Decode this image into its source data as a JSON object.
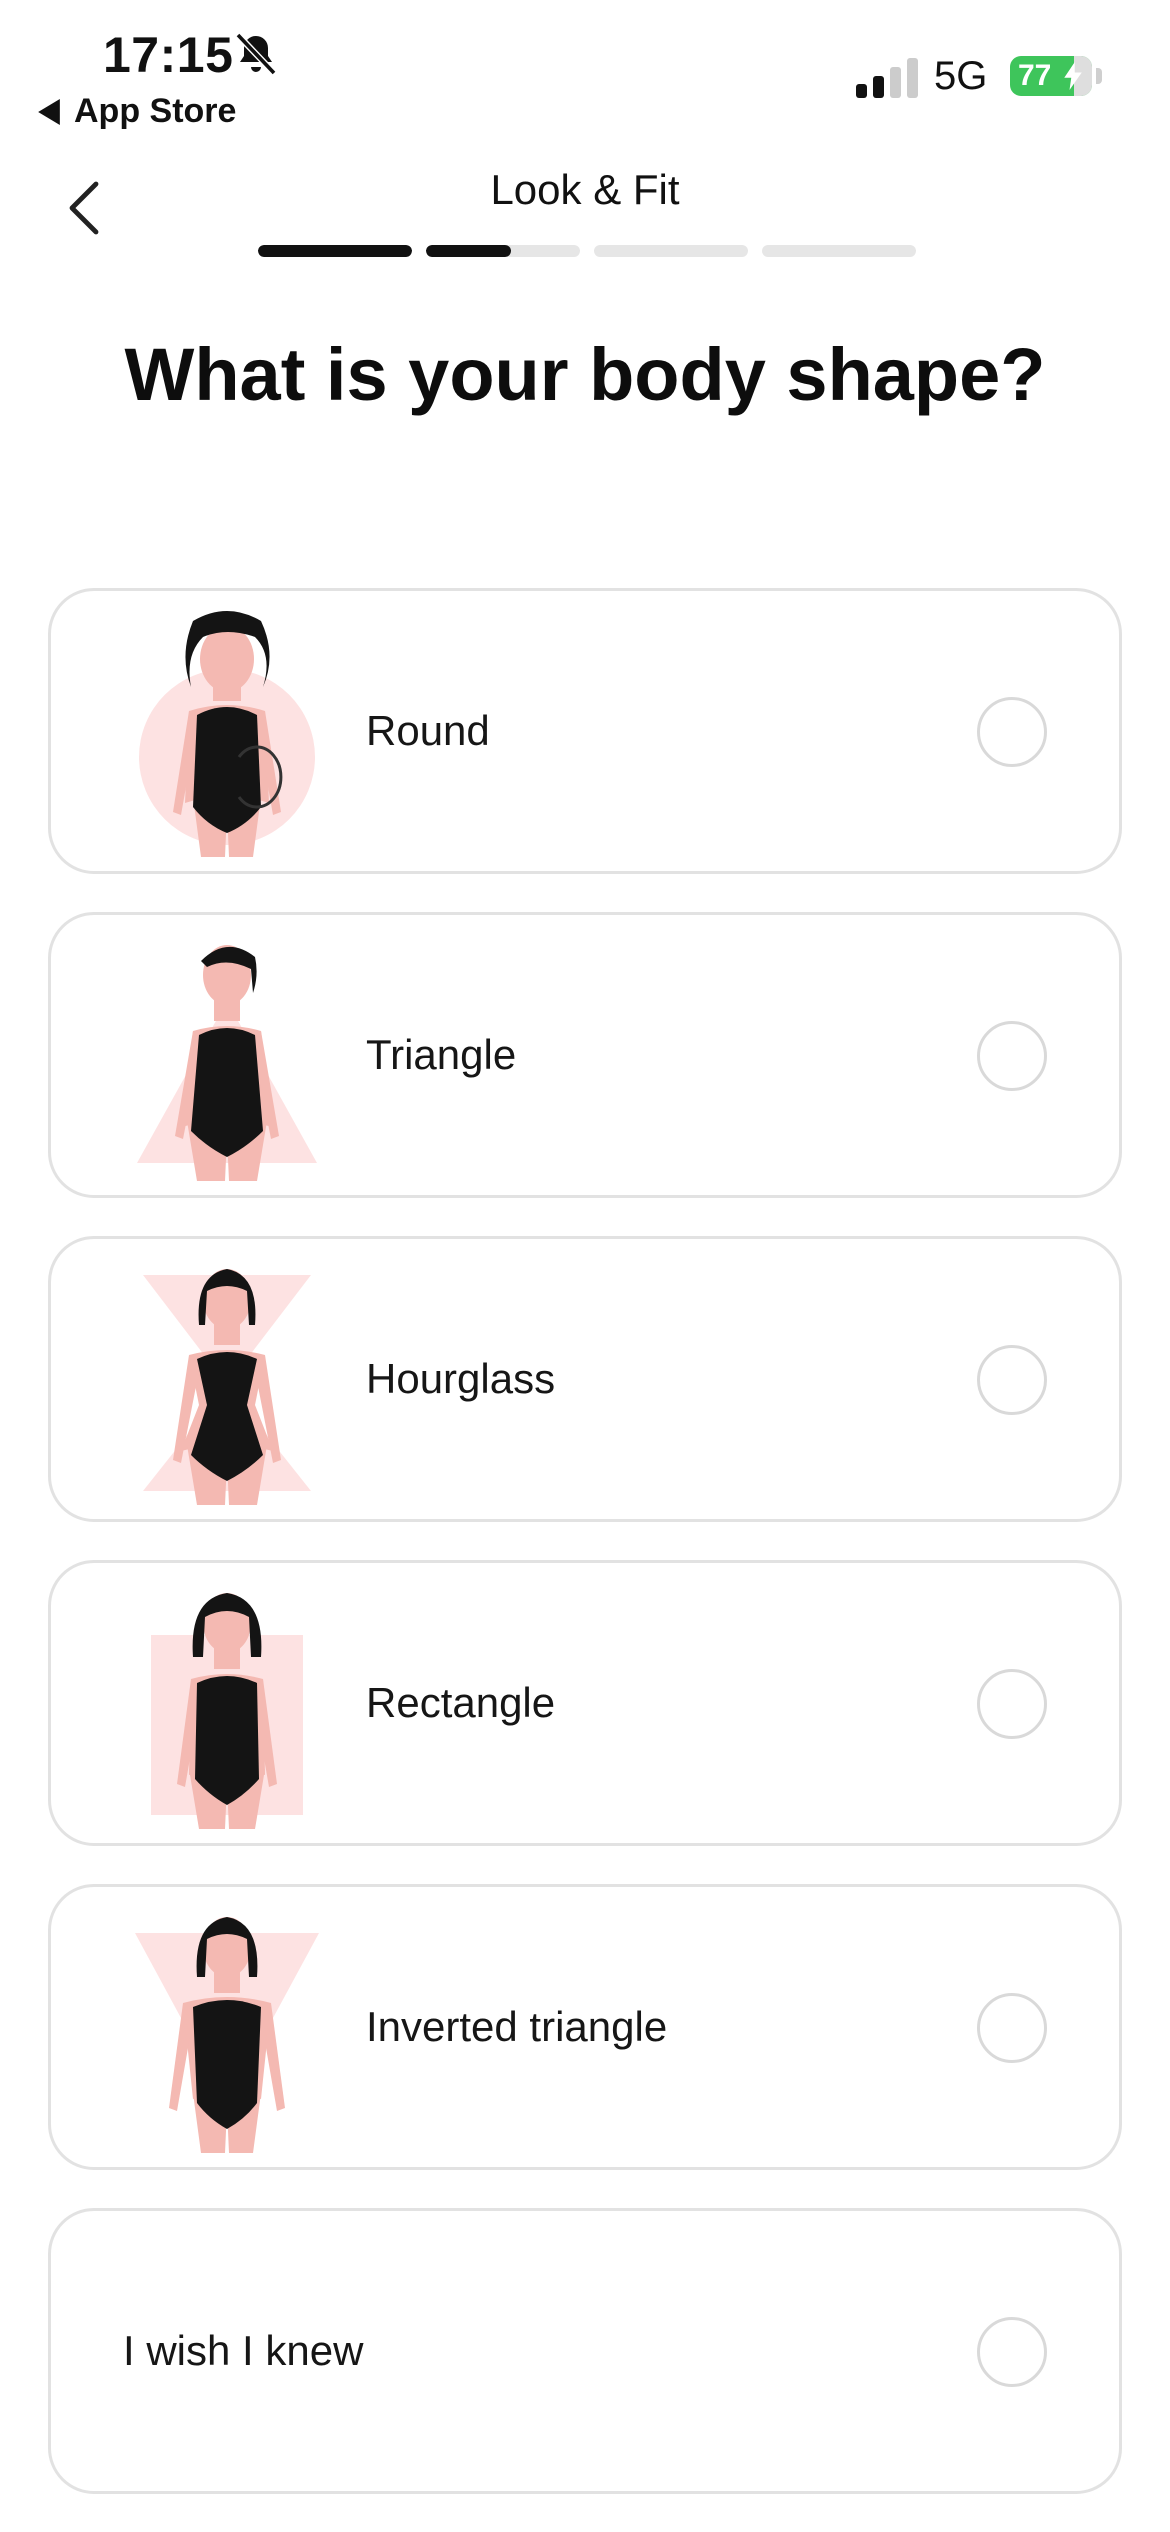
{
  "status_bar": {
    "time": "17:15",
    "back_app": "App Store",
    "network": "5G",
    "battery": "77"
  },
  "header": {
    "title": "Look & Fit",
    "progress": [
      1.0,
      0.55,
      0.0,
      0.0
    ]
  },
  "question": "What is your body shape?",
  "options": [
    {
      "label": "Round",
      "icon": "round-body-shape-icon"
    },
    {
      "label": "Triangle",
      "icon": "triangle-body-shape-icon"
    },
    {
      "label": "Hourglass",
      "icon": "hourglass-body-shape-icon"
    },
    {
      "label": "Rectangle",
      "icon": "rectangle-body-shape-icon"
    },
    {
      "label": "Inverted triangle",
      "icon": "inverted-triangle-body-shape-icon"
    },
    {
      "label": "I wish I knew",
      "icon": ""
    }
  ],
  "colors": {
    "accent": "#111111",
    "shape_highlight": "#fde2e2",
    "skin": "#f4b9b2",
    "battery": "#3ec55b"
  }
}
